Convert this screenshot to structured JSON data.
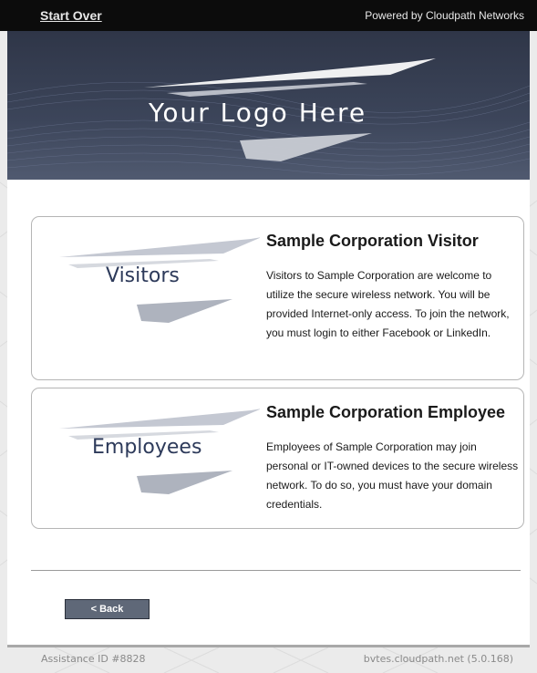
{
  "header": {
    "start_over": "Start Over",
    "powered_by": "Powered by Cloudpath Networks"
  },
  "banner": {
    "logo_text": "Your Logo Here"
  },
  "options": [
    {
      "tag": "Visitors",
      "title": "Sample Corporation Visitor",
      "description": "Visitors to Sample Corporation are welcome to utilize the secure wireless network. You will be provided Internet-only access. To join the network, you must login to either Facebook or LinkedIn."
    },
    {
      "tag": "Employees",
      "title": "Sample Corporation Employee",
      "description": "Employees of Sample Corporation may join personal or IT-owned devices to the secure wireless network. To do so, you must have your domain credentials."
    }
  ],
  "actions": {
    "back": "< Back"
  },
  "footer": {
    "assistance_id": "Assistance ID #8828",
    "host": "bvtes.cloudpath.net (5.0.168)"
  },
  "colors": {
    "banner": "#3a4358",
    "button": "#5f6878",
    "brand_text": "#2d3a5a"
  }
}
